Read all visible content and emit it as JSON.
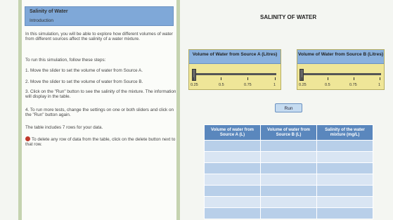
{
  "intro": {
    "title": "Salinity of Water",
    "subtitle": "Introduction"
  },
  "instructions": {
    "p1": "In this simulation, you will be able to explore how different volumes of water from different sources affect the salinity of a water mixture.",
    "p2": "To run this simulation, follow these steps:",
    "step1": "1.  Move the slider to set the volume of water from Source A.",
    "step2": "2.  Move the slider to set the volume of water from Source B.",
    "step3": "3.  Click on the \"Run\" button to see the salinity of the mixture. The information will display in the table.",
    "step4": "4.  To run more tests, change the settings on one or both sliders and click on the \"Run\" button again.",
    "rows_note": "The table includes 7 rows for your data.",
    "delete_note": "To delete any row of data from the table, click on the delete button next to that row."
  },
  "page_title": "SALINITY OF WATER",
  "slider_a": {
    "label": "Volume of Water from Source A (Litres)",
    "value": 0.25,
    "ticks": [
      "0.25",
      "0.5",
      "0.75",
      "1"
    ]
  },
  "slider_b": {
    "label": "Volume of Water from Source B (Litres)",
    "value": 0.25,
    "ticks": [
      "0.25",
      "0.5",
      "0.75",
      "1"
    ]
  },
  "run_label": "Run",
  "table": {
    "headers": [
      "Volume of water from Source A (L)",
      "Volume of water from Source B (L)",
      "Salinity of the water mixture (mg/L)"
    ],
    "rows": [
      [
        "",
        "",
        ""
      ],
      [
        "",
        "",
        ""
      ],
      [
        "",
        "",
        ""
      ],
      [
        "",
        "",
        ""
      ],
      [
        "",
        "",
        ""
      ],
      [
        "",
        "",
        ""
      ],
      [
        "",
        "",
        ""
      ]
    ]
  },
  "colors": {
    "header_blue": "#7fa8d8",
    "slider_yellow": "#efe698",
    "table_header": "#5a87bd",
    "delete_red": "#c0392b"
  }
}
